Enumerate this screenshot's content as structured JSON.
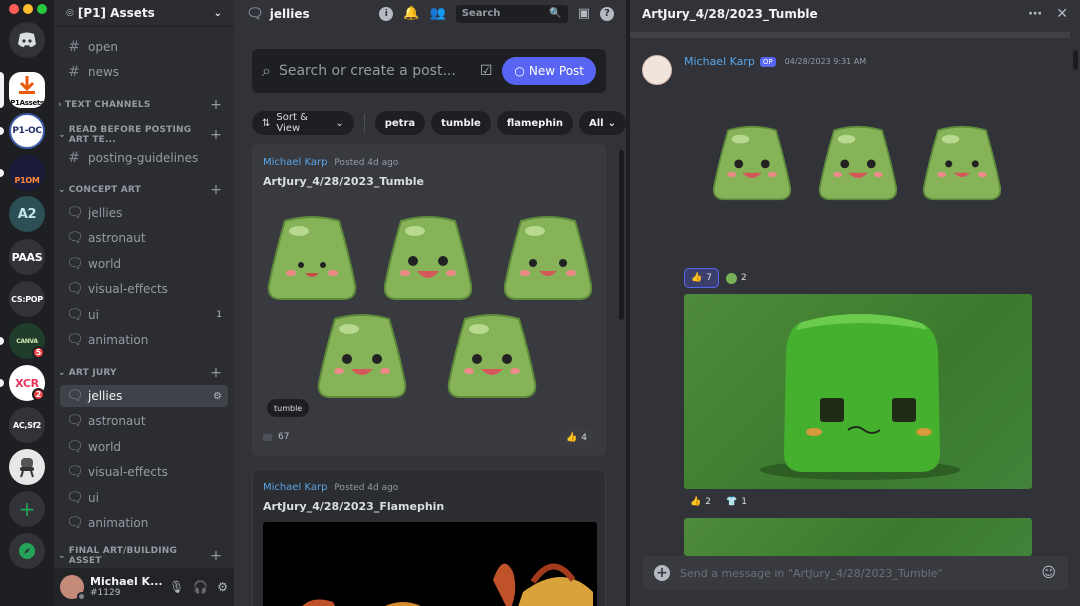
{
  "window": {
    "traffic_colors": [
      "#ff5f57",
      "#febc2e",
      "#28c840"
    ]
  },
  "servers": [
    {
      "label": "",
      "icon": "discord-icon",
      "bg": "#313338"
    },
    {
      "label": "P1Assets",
      "icon": "download-icon",
      "bg": "#ffffff"
    },
    {
      "label": "P1-OC",
      "bg": "#ffffff"
    },
    {
      "label": "P1OM",
      "bg": "#1b1b3a"
    },
    {
      "label": "A2",
      "bg": "#2b4f55"
    },
    {
      "label": "PAAS",
      "bg": "#313338"
    },
    {
      "label": "CS:POP",
      "bg": "#313338"
    },
    {
      "label": "CANVA",
      "bg": "#1f3d2a",
      "badge": "5"
    },
    {
      "label": "XCR",
      "bg": "#ffffff",
      "badge": "2"
    },
    {
      "label": "AC,Sf2",
      "bg": "#313338"
    },
    {
      "label": "",
      "icon": "chair-icon",
      "bg": "#e7e7e7"
    }
  ],
  "sidebar": {
    "guild_name": "[P1] Assets",
    "top_channels": [
      "open",
      "news"
    ],
    "categories": {
      "text": "TEXT CHANNELS",
      "read_before": "READ BEFORE POSTING ART TE...",
      "concept": "CONCEPT ART",
      "art_jury": "ART JURY",
      "final": "FINAL ART/BUILDING ASSET"
    },
    "guidelines": "posting-guidelines",
    "concept_channels": [
      "jellies",
      "astronaut",
      "world",
      "visual-effects",
      "ui",
      "animation"
    ],
    "concept_ui_count": "1",
    "jury_channels": [
      "jellies",
      "astronaut",
      "world",
      "visual-effects",
      "ui",
      "animation"
    ],
    "user": {
      "name": "Michael K...",
      "tag": "#1129"
    }
  },
  "forum": {
    "channel_name": "jellies",
    "search_placeholder": "Search",
    "search_post_placeholder": "Search or create a post...",
    "new_post_label": "New Post",
    "sort_label": "Sort & View",
    "tags": [
      "petra",
      "tumble",
      "flamephin"
    ],
    "all_label": "All",
    "posts": [
      {
        "author": "Michael Karp",
        "posted": "Posted 4d ago",
        "title": "ArtJury_4/28/2023_Tumble",
        "tag": "tumble",
        "messages": "67",
        "reaction_count": "4"
      },
      {
        "author": "Michael Karp",
        "posted": "Posted 4d ago",
        "title": "ArtJury_4/28/2023_Flamephin"
      }
    ]
  },
  "thread": {
    "title": "ArtJury_4/28/2023_Tumble",
    "author": "Michael Karp",
    "op_label": "OP",
    "timestamp": "04/28/2023 9:31 AM",
    "reactions_1": [
      {
        "icon": "thumbs-up",
        "count": "7"
      },
      {
        "icon": "green-circle",
        "count": "2"
      }
    ],
    "reactions_2": [
      {
        "icon": "thumbs-up",
        "count": "2"
      },
      {
        "icon": "shirt",
        "count": "1"
      }
    ],
    "composer_placeholder": "Send a message in \"ArtJury_4/28/2023_Tumble\""
  },
  "colors": {
    "accent": "#5865f2",
    "jelly": "#86b358",
    "jelly_dark": "#5e8c3a",
    "blush": "#f08a8a"
  }
}
